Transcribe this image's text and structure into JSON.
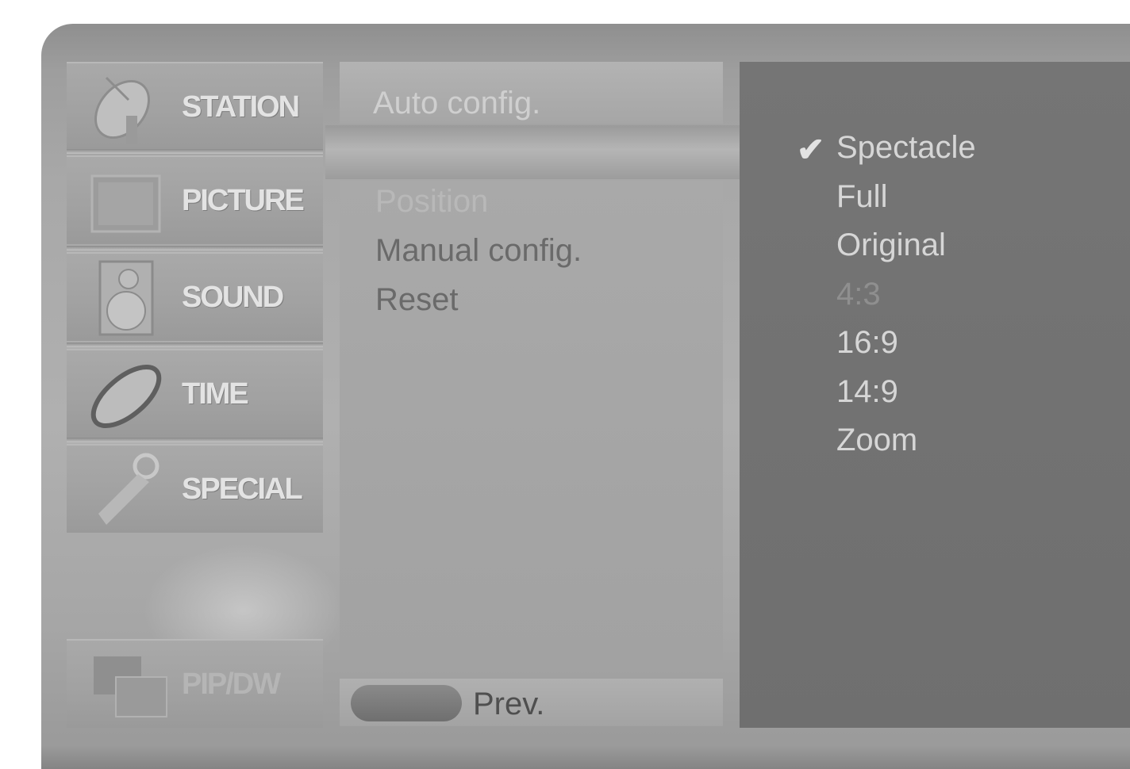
{
  "sidebar": {
    "items": [
      {
        "label": "STATION",
        "icon": "satellite-dish-icon"
      },
      {
        "label": "PICTURE",
        "icon": "monitor-icon"
      },
      {
        "label": "SOUND",
        "icon": "speaker-icon"
      },
      {
        "label": "TIME",
        "icon": "clock-icon"
      },
      {
        "label": "SPECIAL",
        "icon": "key-icon"
      },
      {
        "label": "PIP/DW",
        "icon": "pip-windows-icon"
      }
    ]
  },
  "submenu": {
    "header": "Auto config.",
    "items": [
      "Position",
      "Manual config.",
      "Reset"
    ]
  },
  "footer": {
    "prev_label": "Prev."
  },
  "options": {
    "selected": "Spectacle",
    "items": [
      "Spectacle",
      "Full",
      "Original",
      "4:3",
      "16:9",
      "14:9",
      "Zoom"
    ],
    "check_glyph": "✔"
  }
}
